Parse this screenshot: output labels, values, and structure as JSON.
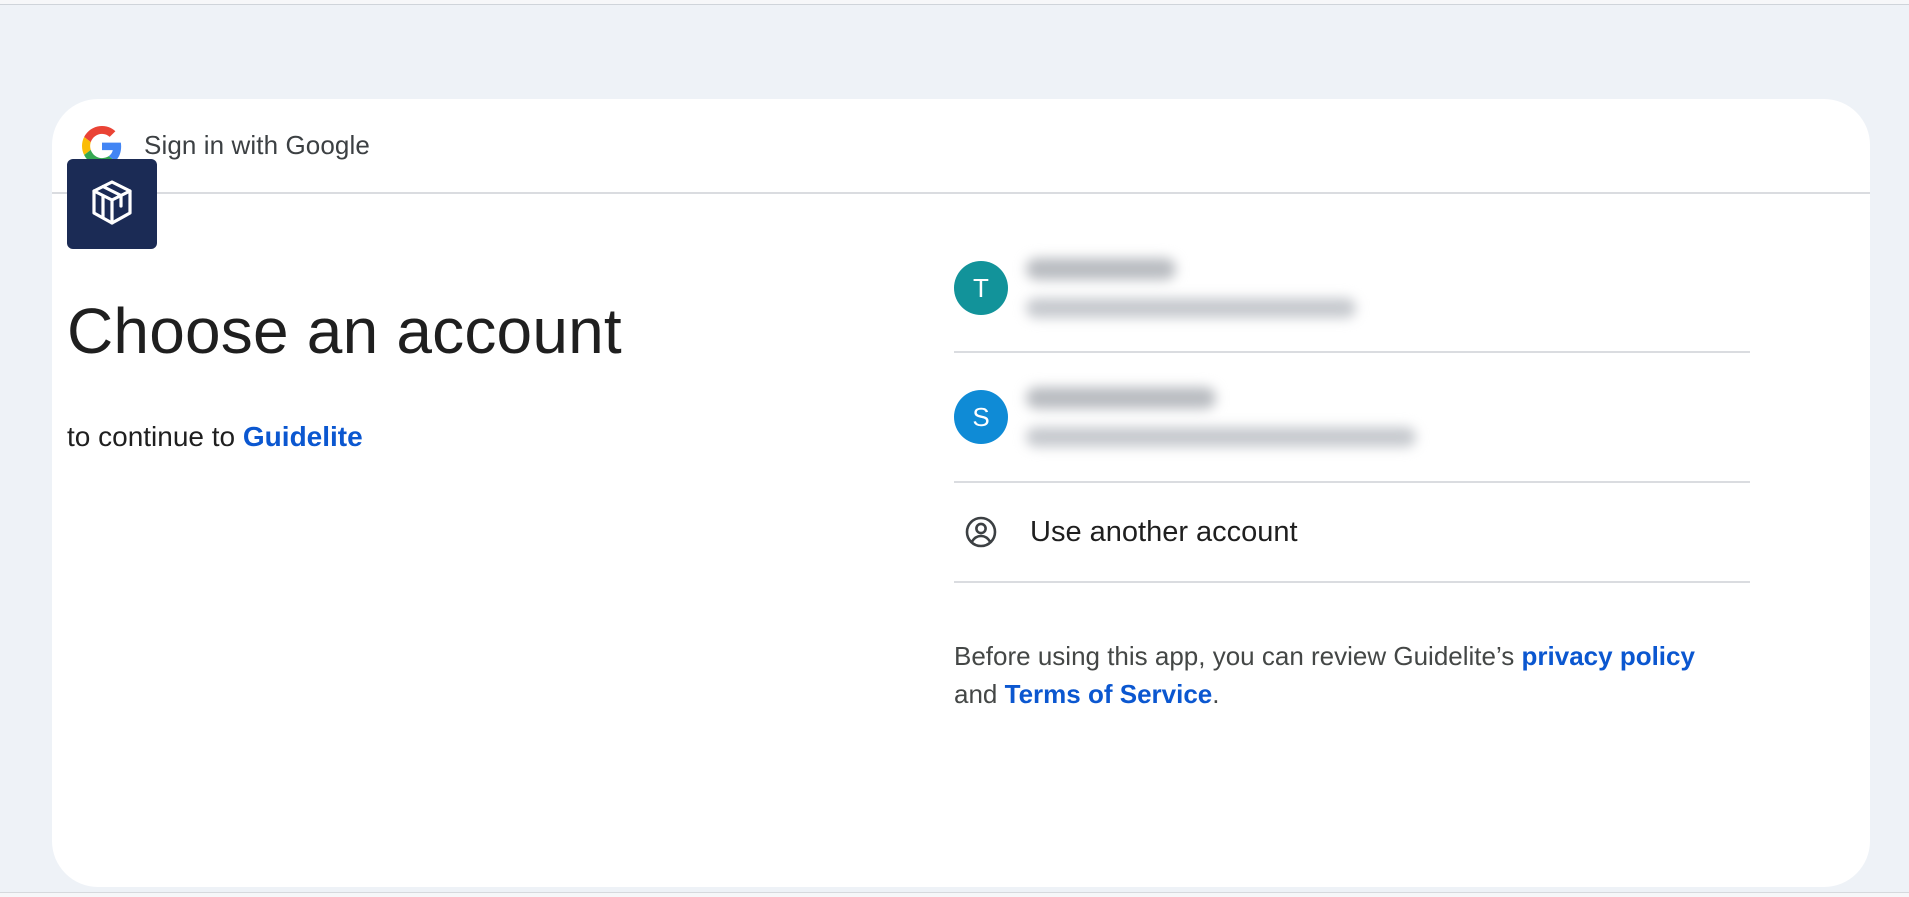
{
  "header": {
    "title": "Sign in with Google",
    "logo_icon": "google-g-icon"
  },
  "left": {
    "app_logo_icon": "guidelite-cube-logo",
    "heading": "Choose an account",
    "continue_prefix": "to continue to",
    "app_name": "Guidelite"
  },
  "accounts": [
    {
      "initial": "T",
      "avatar_color": "#12939a"
    },
    {
      "initial": "S",
      "avatar_color": "#0f8bd6"
    }
  ],
  "use_another": {
    "label": "Use another account",
    "icon": "account-circle-icon"
  },
  "footer": {
    "text_before": "Before using this app, you can review Guidelite’s",
    "privacy_link": "privacy policy",
    "text_and": "and",
    "terms_link": "Terms of Service",
    "text_end": "."
  },
  "colors": {
    "link": "#0b57d0",
    "app_logo_bg": "#1b2b55",
    "background": "#eef2f7"
  }
}
